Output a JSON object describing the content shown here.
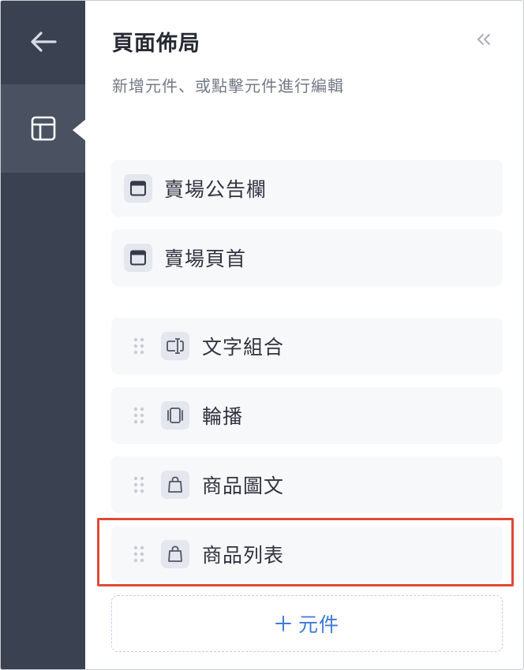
{
  "rail": {
    "back_icon": "arrow-left-icon",
    "layout_icon": "layout-icon"
  },
  "panel": {
    "title": "頁面佈局",
    "subtitle": "新增元件、或點擊元件進行編輯",
    "collapse_icon": "double-chevron-left-icon"
  },
  "fixed_components": [
    {
      "label": "賣場公告欄",
      "icon": "window-icon"
    },
    {
      "label": "賣場頁首",
      "icon": "window-icon"
    }
  ],
  "components": [
    {
      "label": "文字組合",
      "icon": "text-cursor-icon"
    },
    {
      "label": "輪播",
      "icon": "carousel-icon"
    },
    {
      "label": "商品圖文",
      "icon": "shopping-bag-icon"
    },
    {
      "label": "商品列表",
      "icon": "shopping-bag-icon"
    }
  ],
  "add_button": {
    "plus": "+",
    "label": "元件"
  },
  "colors": {
    "rail": "#3a4150",
    "rail_active": "#4a5160",
    "accent": "#3f7ad7",
    "highlight": "#e04a36"
  }
}
